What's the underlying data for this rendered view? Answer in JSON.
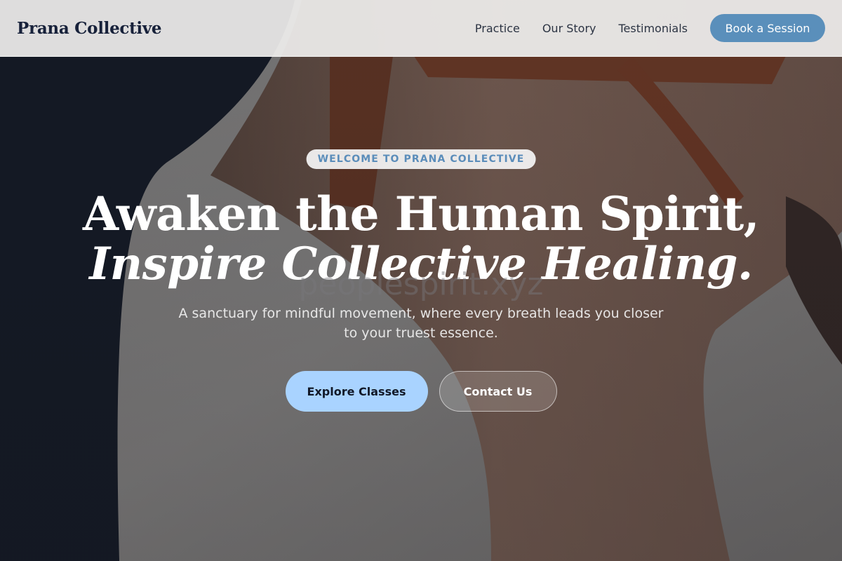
{
  "header": {
    "brand": "Prana Collective",
    "nav": [
      {
        "label": "Practice"
      },
      {
        "label": "Our Story"
      },
      {
        "label": "Testimonials"
      }
    ],
    "cta_label": "Book a Session"
  },
  "hero": {
    "eyebrow": "WELCOME TO PRANA COLLECTIVE",
    "headline_line1": "Awaken the Human Spirit,",
    "headline_line2": "Inspire Collective Healing.",
    "watermark": "peoplespirit.xyz",
    "subtitle": "A sanctuary for mindful movement, where every breath leads you closer to your truest essence.",
    "primary_cta": "Explore Classes",
    "secondary_cta": "Contact Us"
  },
  "colors": {
    "accent": "#5a8fbb",
    "primary_button": "#a9d3ff",
    "brand_text": "#17213a",
    "header_bg": "#eeedec"
  }
}
